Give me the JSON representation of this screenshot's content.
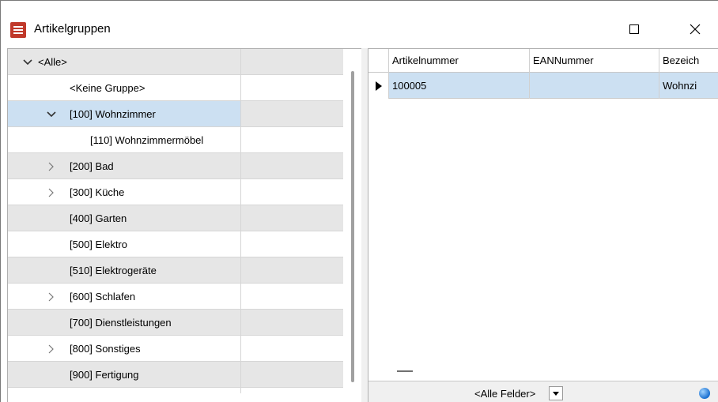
{
  "window": {
    "title": "Artikelgruppen"
  },
  "tree": {
    "items": [
      {
        "label": "<Alle>",
        "toggle": "expanded"
      },
      {
        "label": "<Keine Gruppe>",
        "toggle": "none"
      },
      {
        "label": "[100] Wohnzimmer",
        "toggle": "expanded"
      },
      {
        "label": "[110] Wohnzimmermöbel",
        "toggle": "none"
      },
      {
        "label": "[200] Bad",
        "toggle": "collapsed"
      },
      {
        "label": "[300] Küche",
        "toggle": "collapsed"
      },
      {
        "label": "[400] Garten",
        "toggle": "none"
      },
      {
        "label": "[500] Elektro",
        "toggle": "none"
      },
      {
        "label": "[510] Elektrogeräte",
        "toggle": "none"
      },
      {
        "label": "[600] Schlafen",
        "toggle": "collapsed"
      },
      {
        "label": "[700] Dienstleistungen",
        "toggle": "none"
      },
      {
        "label": "[800] Sonstiges",
        "toggle": "collapsed"
      },
      {
        "label": "[900] Fertigung",
        "toggle": "none"
      }
    ]
  },
  "grid": {
    "columns": [
      "Artikelnummer",
      "EANNummer",
      "Bezeich"
    ],
    "rows": [
      {
        "artikelnummer": "100005",
        "eannummer": "",
        "bezeichnung": "Wohnzi"
      }
    ]
  },
  "filter": {
    "field": "<Alle Felder>"
  },
  "icons": {
    "app": "app-icon",
    "maximize": "maximize-icon",
    "close": "close-icon",
    "expand": "chevron-down-icon",
    "collapse": "chevron-right-icon",
    "row_pointer": "row-pointer-icon",
    "dropdown": "dropdown-arrow-icon",
    "globe": "globe-icon"
  },
  "colors": {
    "selected_row": "#cce0f2",
    "alt_row": "#e6e6e6",
    "app_icon": "#c0392b"
  }
}
